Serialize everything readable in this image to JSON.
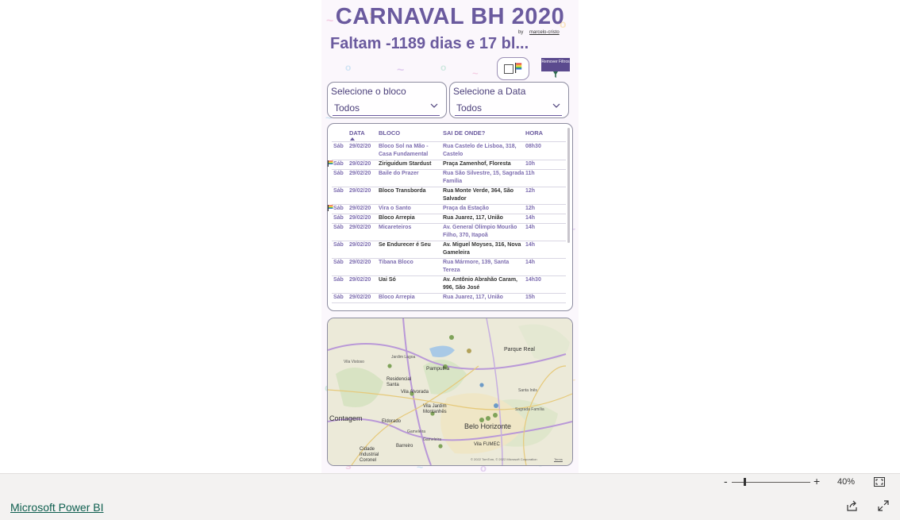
{
  "report": {
    "title": "CARNAVAL BH 2020",
    "byline_prefix": "by",
    "byline_author": "marcelo-cristo",
    "countdown": "Faltam -1189 dias e 17 bl...",
    "remove_filters_label": "Remover Filtros"
  },
  "slicers": [
    {
      "label": "Selecione o bloco",
      "value": "Todos"
    },
    {
      "label": "Selecione a Data",
      "value": "Todos"
    }
  ],
  "table": {
    "headers": [
      "DATA",
      "BLOCO",
      "SAI DE ONDE?",
      "HORA"
    ],
    "rows": [
      {
        "day": "Sáb",
        "date": "29/02/20",
        "bloco": "Bloco Sol na Mão - Casa Fundamental",
        "local": "Rua Castelo de Lisboa, 318, Castelo",
        "hora": "08h30",
        "flag": false
      },
      {
        "day": "Sáb",
        "date": "29/02/20",
        "bloco": "Ziriguidum Stardust",
        "local": "Praça Zamenhof, Floresta",
        "hora": "10h",
        "flag": true
      },
      {
        "day": "Sáb",
        "date": "29/02/20",
        "bloco": "Baile do Prazer",
        "local": "Rua São Silvestre, 15, Sagrada Família",
        "hora": "11h",
        "flag": false
      },
      {
        "day": "Sáb",
        "date": "29/02/20",
        "bloco": "Bloco Transborda",
        "local": "Rua Monte Verde, 364, São Salvador",
        "hora": "12h",
        "flag": false
      },
      {
        "day": "Sáb",
        "date": "29/02/20",
        "bloco": "Vira o Santo",
        "local": "Praça da Estação",
        "hora": "12h",
        "flag": true
      },
      {
        "day": "Sáb",
        "date": "29/02/20",
        "bloco": "Bloco Arrepia",
        "local": "Rua Juarez, 117, União",
        "hora": "14h",
        "flag": false
      },
      {
        "day": "Sáb",
        "date": "29/02/20",
        "bloco": "Micareteiros",
        "local": "Av. General Olímpio Mourão Filho, 370, Itapoã",
        "hora": "14h",
        "flag": false
      },
      {
        "day": "Sáb",
        "date": "29/02/20",
        "bloco": "Se Endurecer é Seu",
        "local": "Av. Miguel Moyses, 316, Nova Gameleira",
        "hora": "14h",
        "flag": false
      },
      {
        "day": "Sáb",
        "date": "29/02/20",
        "bloco": "Tibana Bloco",
        "local": "Rua Mármore, 139, Santa Tereza",
        "hora": "14h",
        "flag": false
      },
      {
        "day": "Sáb",
        "date": "29/02/20",
        "bloco": "Uai Só",
        "local": "Av. Antônio Abrahão Caram, 996, São José",
        "hora": "14h30",
        "flag": false
      },
      {
        "day": "Sáb",
        "date": "29/02/20",
        "bloco": "Bloco Arrepia",
        "local": "Rua Juarez, 117, União",
        "hora": "15h",
        "flag": false
      }
    ]
  },
  "map": {
    "labels": [
      "Parque Real",
      "Pampulha",
      "Residencial Santa",
      "Vila Alvorada",
      "Vila Jardim Montanhês",
      "Belo Horizonte",
      "Contagem",
      "Eldorado",
      "Cidade Industrial Coronel",
      "Barreiro",
      "Vila FUMEC",
      "Gameleira",
      "Sagrada Família",
      "Santa Inês",
      "Gameleira",
      "Vila Vistoso",
      "Jardim Lagoa"
    ],
    "credit": "© 2022 TomTom, © 2022 Microsoft Corporation",
    "terms": "Terms"
  },
  "toolbar": {
    "zoom_minus": "-",
    "zoom_plus": "+",
    "zoom_percent": 40,
    "zoom_level": "40%"
  },
  "footer": {
    "link": "Microsoft Power BI"
  },
  "colors": {
    "accent": "#6a5a9e",
    "button": "#5b4a8e",
    "link": "#0e5f4f"
  }
}
